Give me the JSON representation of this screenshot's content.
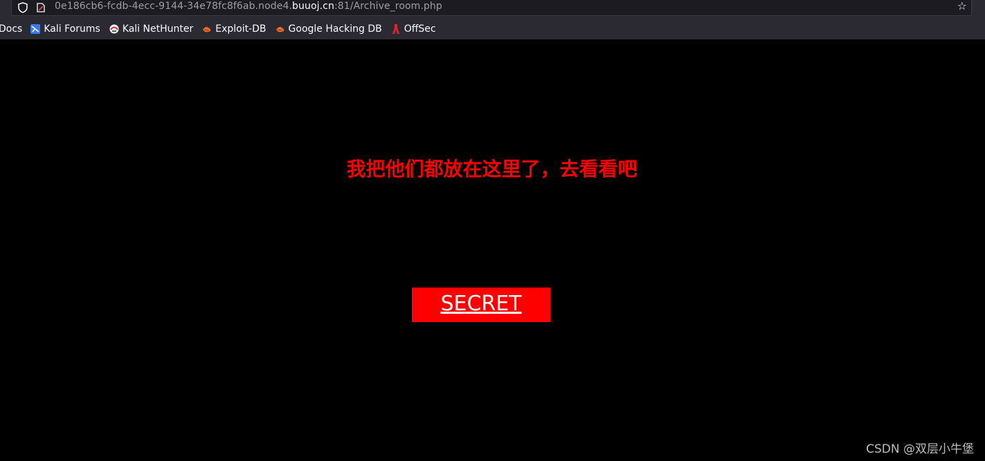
{
  "browser": {
    "url_prefix": "0e186cb6-fcdb-4ecc-9144-34e78fc8f6ab.node4.",
    "url_host": "buuoj.cn",
    "url_suffix": ":81/Archive_room.php",
    "bookmarks": [
      {
        "label": "Docs",
        "icon": "docs-icon"
      },
      {
        "label": "Kali Forums",
        "icon": "kali-forums-icon"
      },
      {
        "label": "Kali NetHunter",
        "icon": "kali-nethunter-icon"
      },
      {
        "label": "Exploit-DB",
        "icon": "exploit-db-icon"
      },
      {
        "label": "Google Hacking DB",
        "icon": "google-hacking-db-icon"
      },
      {
        "label": "OffSec",
        "icon": "offsec-icon"
      }
    ]
  },
  "page": {
    "headline": "我把他们都放在这里了，去看看吧",
    "secret_label": "SECRET"
  },
  "watermark": "CSDN @双层小牛堡",
  "colors": {
    "background": "#000000",
    "headline": "#ff0000",
    "button_bg": "#ff0000",
    "button_text": "#ffffff"
  }
}
